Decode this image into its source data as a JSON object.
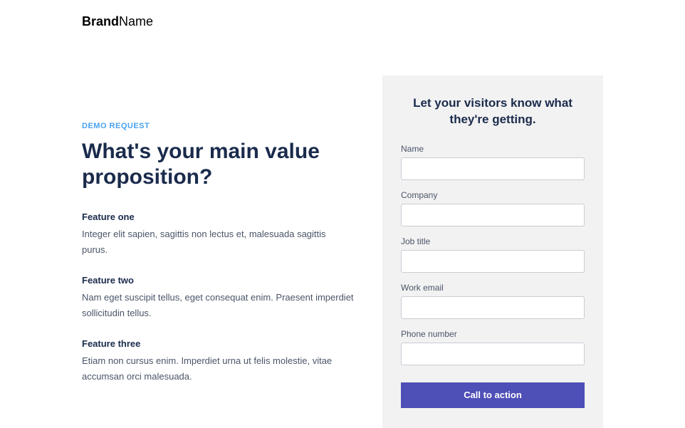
{
  "brand": {
    "bold": "Brand",
    "light": "Name"
  },
  "left": {
    "eyebrow": "DEMO REQUEST",
    "headline": "What's your main value proposition?",
    "features": [
      {
        "title": "Feature one",
        "desc": "Integer elit sapien, sagittis non lectus et, malesuada sagittis purus."
      },
      {
        "title": "Feature two",
        "desc": "Nam eget suscipit tellus, eget consequat enim. Praesent imperdiet sollicitudin tellus."
      },
      {
        "title": "Feature three",
        "desc": "Etiam non cursus enim. Imperdiet urna ut felis molestie, vitae accumsan orci malesuada."
      }
    ]
  },
  "form": {
    "title": "Let your visitors know what they're getting.",
    "fields": [
      {
        "label": "Name"
      },
      {
        "label": "Company"
      },
      {
        "label": "Job title"
      },
      {
        "label": "Work email"
      },
      {
        "label": "Phone number"
      }
    ],
    "cta": "Call to action"
  }
}
